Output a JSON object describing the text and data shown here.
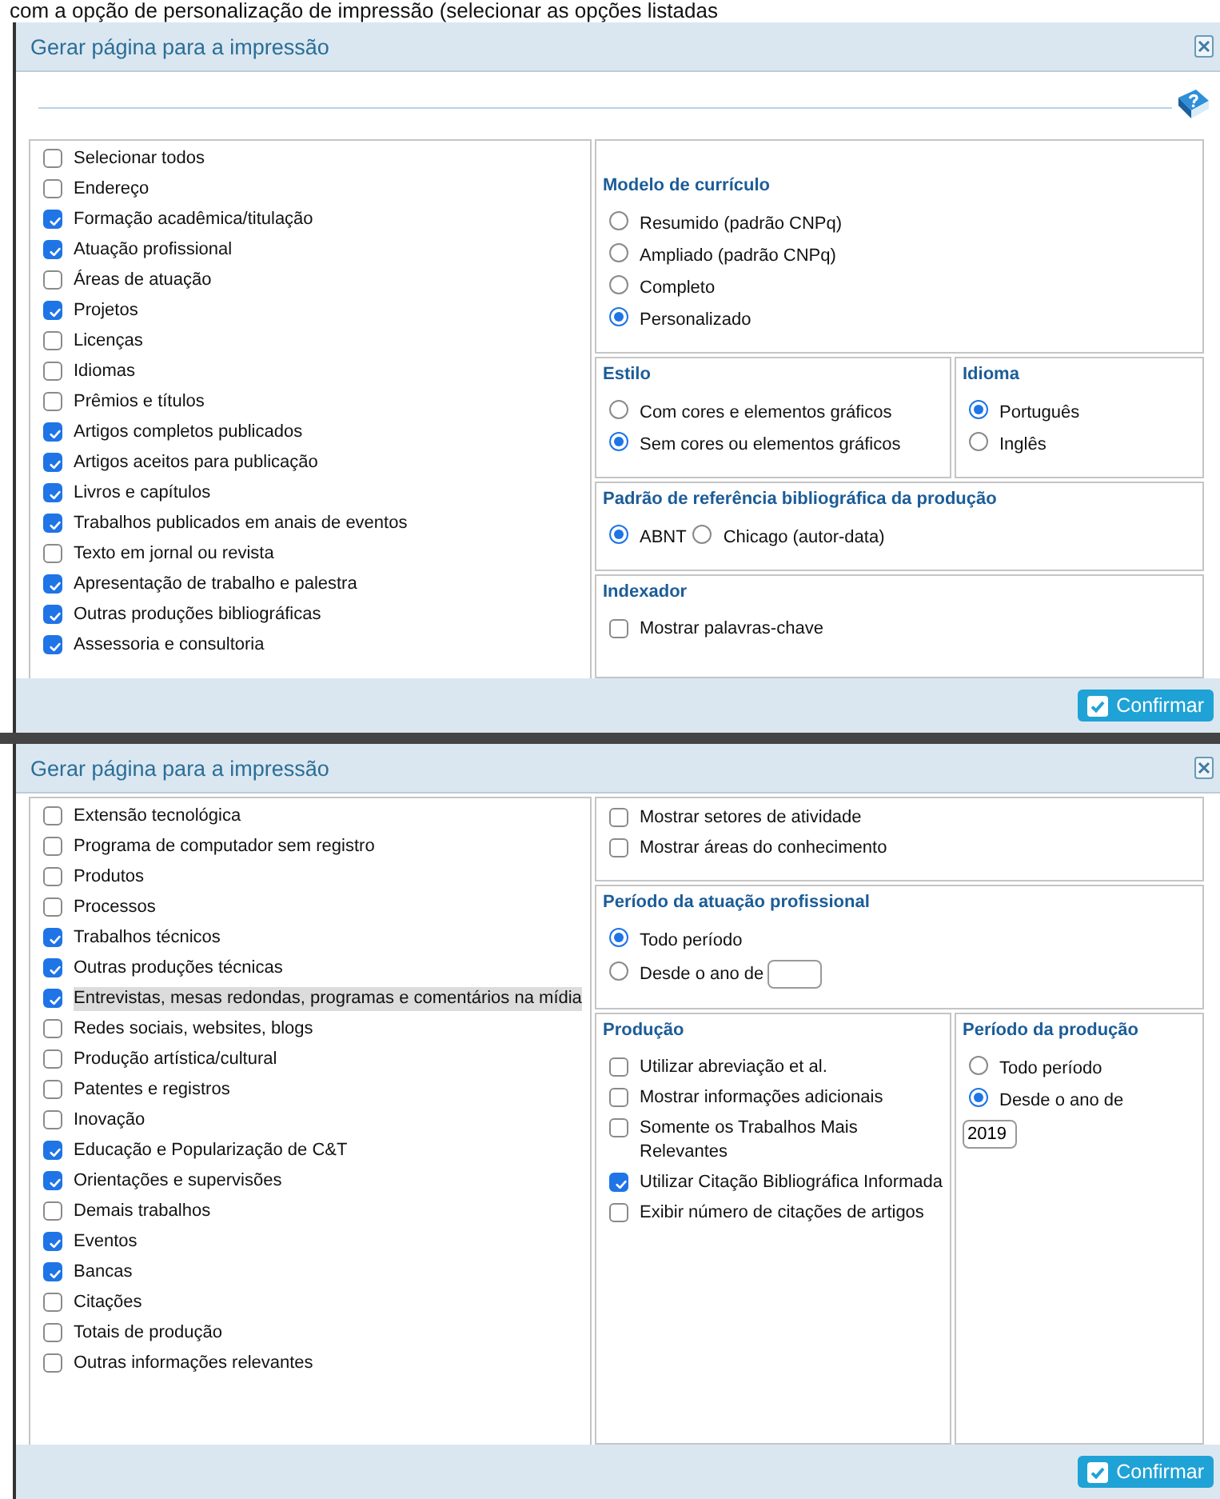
{
  "caption": "com a opção de personalização de impressão (selecionar as opções listadas",
  "dialogs": [
    {
      "title": "Gerar página para a impressão",
      "help": true,
      "left_items": [
        {
          "label": "Selecionar todos",
          "checked": false
        },
        {
          "label": "Endereço",
          "checked": false
        },
        {
          "label": "Formação acadêmica/titulação",
          "checked": true
        },
        {
          "label": "Atuação profissional",
          "checked": true
        },
        {
          "label": "Áreas de atuação",
          "checked": false
        },
        {
          "label": "Projetos",
          "checked": true
        },
        {
          "label": "Licenças",
          "checked": false
        },
        {
          "label": "Idiomas",
          "checked": false
        },
        {
          "label": "Prêmios e títulos",
          "checked": false
        },
        {
          "label": "Artigos completos publicados",
          "checked": true
        },
        {
          "label": "Artigos aceitos para publicação",
          "checked": true
        },
        {
          "label": "Livros e capítulos",
          "checked": true
        },
        {
          "label": "Trabalhos publicados em anais de eventos",
          "checked": true
        },
        {
          "label": "Texto em jornal ou revista",
          "checked": false
        },
        {
          "label": "Apresentação de trabalho e palestra",
          "checked": true
        },
        {
          "label": "Outras produções bibliográficas",
          "checked": true
        },
        {
          "label": "Assessoria e consultoria",
          "checked": true
        }
      ],
      "rows": [
        {
          "panels": [
            {
              "title": "Modelo de currículo",
              "items": [
                {
                  "kind": "radio",
                  "label": "Resumido (padrão CNPq)",
                  "selected": false
                },
                {
                  "kind": "radio",
                  "label": "Ampliado (padrão CNPq)",
                  "selected": false
                },
                {
                  "kind": "radio",
                  "label": "Completo",
                  "selected": false
                },
                {
                  "kind": "radio",
                  "label": "Personalizado",
                  "selected": true
                }
              ]
            }
          ]
        },
        {
          "panels": [
            {
              "title": "Estilo",
              "items": [
                {
                  "kind": "radio",
                  "label": "Com cores e elementos gráficos",
                  "selected": false
                },
                {
                  "kind": "radio",
                  "label": "Sem cores ou elementos gráficos",
                  "selected": true
                }
              ]
            },
            {
              "title": "Idioma",
              "items": [
                {
                  "kind": "radio",
                  "label": "Português",
                  "selected": true
                },
                {
                  "kind": "radio",
                  "label": "Inglês",
                  "selected": false
                }
              ]
            }
          ]
        },
        {
          "panels": [
            {
              "title": "Padrão de referência bibliográfica da produção",
              "items": [
                {
                  "kind": "inline-radio",
                  "label": "ABNT",
                  "selected": true
                },
                {
                  "kind": "inline-radio",
                  "label": "Chicago (autor-data)",
                  "selected": false
                }
              ]
            }
          ]
        },
        {
          "panels": [
            {
              "title": "Indexador",
              "items": [
                {
                  "kind": "checkbox",
                  "label": "Mostrar palavras-chave",
                  "checked": false
                }
              ]
            }
          ]
        }
      ],
      "confirm": "Confirmar"
    },
    {
      "title": "Gerar página para a impressão",
      "help": false,
      "left_items": [
        {
          "label": "Extensão tecnológica",
          "checked": false,
          "highlighted": false
        },
        {
          "label": "Programa de computador sem registro",
          "checked": false,
          "highlighted": false
        },
        {
          "label": "Produtos",
          "checked": false,
          "highlighted": false
        },
        {
          "label": "Processos",
          "checked": false,
          "highlighted": false
        },
        {
          "label": "Trabalhos técnicos",
          "checked": true,
          "highlighted": false
        },
        {
          "label": "Outras produções técnicas",
          "checked": true,
          "highlighted": false
        },
        {
          "label": "Entrevistas, mesas redondas, programas e comentários na mídia",
          "checked": true,
          "highlighted": true
        },
        {
          "label": "Redes sociais, websites, blogs",
          "checked": false,
          "highlighted": false
        },
        {
          "label": "Produção artística/cultural",
          "checked": false,
          "highlighted": false
        },
        {
          "label": "Patentes e registros",
          "checked": false,
          "highlighted": false
        },
        {
          "label": "Inovação",
          "checked": false,
          "highlighted": false
        },
        {
          "label": "Educação e Popularização de C&T",
          "checked": true,
          "highlighted": false
        },
        {
          "label": "Orientações e supervisões",
          "checked": true,
          "highlighted": false
        },
        {
          "label": "Demais trabalhos",
          "checked": false,
          "highlighted": false
        },
        {
          "label": "Eventos",
          "checked": true,
          "highlighted": false
        },
        {
          "label": "Bancas",
          "checked": true,
          "highlighted": false
        },
        {
          "label": "Citações",
          "checked": false,
          "highlighted": false
        },
        {
          "label": "Totais de produção",
          "checked": false,
          "highlighted": false
        },
        {
          "label": "Outras informações relevantes",
          "checked": false,
          "highlighted": false
        }
      ],
      "rows": [
        {
          "panels": [
            {
              "items": [
                {
                  "kind": "checkbox",
                  "label": "Mostrar setores de atividade",
                  "checked": false
                },
                {
                  "kind": "checkbox",
                  "label": "Mostrar áreas do conhecimento",
                  "checked": false
                }
              ]
            }
          ]
        },
        {
          "panels": [
            {
              "title": "Período da atuação profissional",
              "items": [
                {
                  "kind": "radio",
                  "label": "Todo período",
                  "selected": true
                },
                {
                  "kind": "radio-field",
                  "label": "Desde o ano de",
                  "selected": false
                }
              ]
            }
          ]
        },
        {
          "panels": [
            {
              "title": "Produção",
              "items": [
                {
                  "kind": "checkbox",
                  "label": "Utilizar abreviação et al.",
                  "checked": false
                },
                {
                  "kind": "checkbox",
                  "label": "Mostrar informações adicionais",
                  "checked": false
                },
                {
                  "kind": "checkbox",
                  "label": "Somente os Trabalhos Mais Relevantes",
                  "checked": false
                },
                {
                  "kind": "checkbox",
                  "label": "Utilizar Citação Bibliográfica Informada",
                  "checked": true
                },
                {
                  "kind": "checkbox",
                  "label": "Exibir número de citações de artigos",
                  "checked": false
                }
              ]
            },
            {
              "title": "Período da produção",
              "items": [
                {
                  "kind": "radio",
                  "label": "Todo período",
                  "selected": false
                },
                {
                  "kind": "radio",
                  "label": "Desde o ano de",
                  "selected": true
                },
                {
                  "kind": "year-field",
                  "value": "2019"
                }
              ]
            }
          ]
        }
      ],
      "confirm": "Confirmar"
    }
  ]
}
